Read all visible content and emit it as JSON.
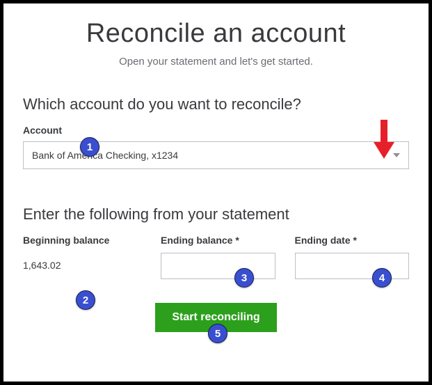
{
  "title": "Reconcile an account",
  "subtitle": "Open your statement and let's get started.",
  "sections": {
    "account_question": "Which account do you want to reconcile?",
    "statement_prompt": "Enter the following from your statement"
  },
  "account": {
    "label": "Account",
    "selected": "Bank of America Checking, x1234"
  },
  "fields": {
    "beginning_balance": {
      "label": "Beginning balance",
      "value": "1,643.02"
    },
    "ending_balance": {
      "label": "Ending balance *",
      "value": ""
    },
    "ending_date": {
      "label": "Ending date *",
      "value": ""
    }
  },
  "button": {
    "start": "Start reconciling"
  },
  "annotations": {
    "b1": "1",
    "b2": "2",
    "b3": "3",
    "b4": "4",
    "b5": "5"
  }
}
